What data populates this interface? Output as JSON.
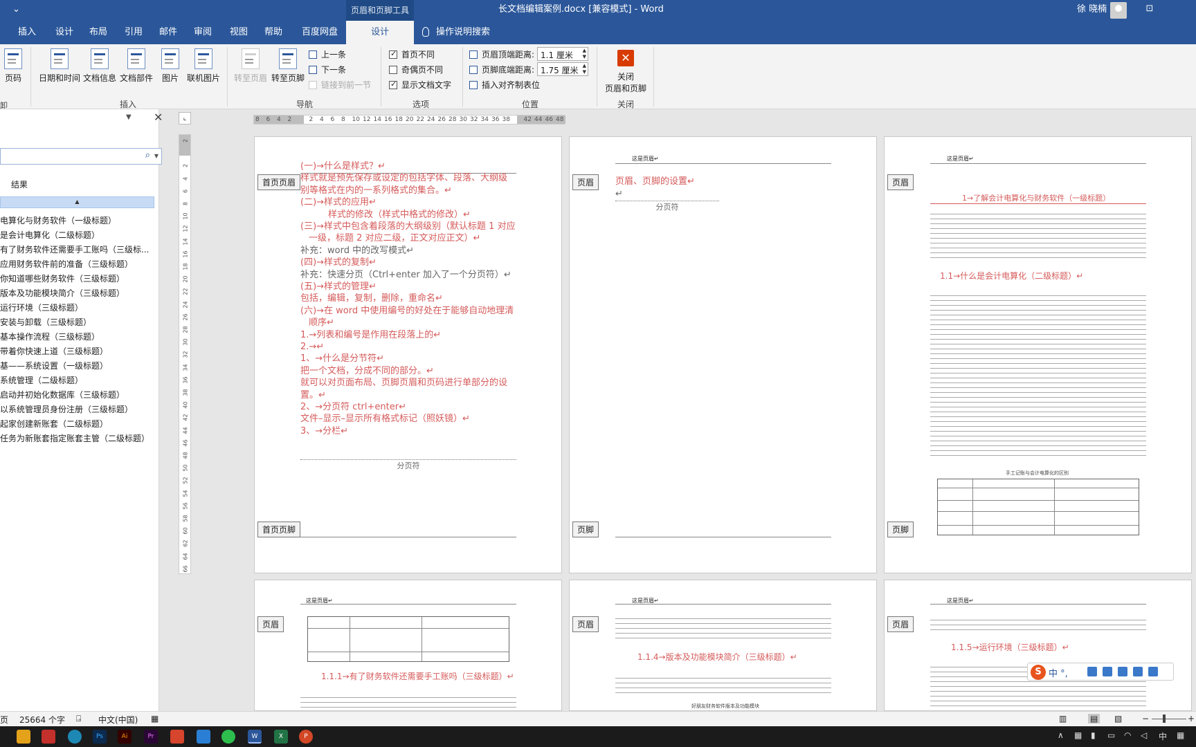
{
  "titlebar": {
    "quick_access": "⌄",
    "context_tab": "页眉和页脚工具",
    "doc_title": "长文档编辑案例.docx [兼容模式]  -  Word",
    "user": "徐 晓楠",
    "ribbon_display_icon": "ribbon-display-icon"
  },
  "tabs": [
    "插入",
    "设计",
    "布局",
    "引用",
    "邮件",
    "审阅",
    "视图",
    "帮助",
    "百度网盘",
    "设计"
  ],
  "tell_me": "操作说明搜索",
  "ribbon": {
    "page_number": "页码",
    "date_time": "日期和时间",
    "doc_info": "文档信息",
    "doc_parts": "文档部件",
    "picture": "图片",
    "online_picture": "联机图片",
    "insert_group": "插入",
    "goto_header": "转至页眉",
    "goto_footer": "转至页脚",
    "previous": "上一条",
    "next": "下一条",
    "link_previous": "链接到前一节",
    "nav_group": "导航",
    "first_page_diff": "首页不同",
    "odd_even_diff": "奇偶页不同",
    "show_doc_text": "显示文档文字",
    "options_group": "选项",
    "header_top_label": "页眉顶端距离:",
    "header_top_value": "1.1 厘米",
    "footer_bottom_label": "页脚底端距离:",
    "footer_bottom_value": "1.75 厘米",
    "insert_align_tab": "插入对齐制表位",
    "position_group": "位置",
    "close_label_1": "关闭",
    "close_label_2": "页眉和页脚",
    "close_group": "关闭",
    "left_stub_1": "印",
    "left_stub_2": "卸"
  },
  "navpane": {
    "results": "结果",
    "items": [
      "电算化与财务软件（一级标题）",
      "是会计电算化（二级标题）",
      "有了财务软件还需要手工账吗（三级标...",
      "应用财务软件前的准备（三级标题）",
      "你知道哪些财务软件（三级标题）",
      "版本及功能模块简介（三级标题）",
      "运行环境（三级标题）",
      "安装与卸载（三级标题）",
      "基本操作流程（三级标题）",
      "带着你快速上道（三级标题）",
      "基——系统设置（一级标题）",
      "系统管理（二级标题）",
      "启动并初始化数据库（三级标题）",
      "以系统管理员身份注册（三级标题）",
      "起家创建新账套（二级标题）",
      "任务为新账套指定账套主管（二级标题）"
    ]
  },
  "ruler": {
    "h_numbers": [
      "8",
      "6",
      "4",
      "2",
      "",
      "2",
      "4",
      "6",
      "8",
      "10",
      "12",
      "14",
      "16",
      "18",
      "20",
      "22",
      "24",
      "26",
      "28",
      "30",
      "32",
      "34",
      "36",
      "38",
      "",
      "42",
      "44",
      "46",
      "48"
    ],
    "v_numbers": [
      "2",
      "",
      "2",
      "4",
      "6",
      "8",
      "10",
      "12",
      "14",
      "16",
      "18",
      "20",
      "22",
      "24",
      "26",
      "28",
      "30",
      "32",
      "34",
      "36",
      "38",
      "40",
      "42",
      "44",
      "46",
      "48",
      "50",
      "52",
      "54",
      "56",
      "58",
      "60",
      "62",
      "64",
      "66"
    ]
  },
  "pages": {
    "p1": {
      "header_tag": "首页页眉",
      "footer_tag": "首页页脚",
      "lines": [
        "(一)→什么是样式？↵",
        "样式就是预先保存或设定的包括字体、段落、大纲级",
        "别等格式在内的一系列格式的集合。↵",
        "(二)→样式的应用↵",
        "样式的修改（样式中格式的修改）↵",
        "(三)→样式中包含着段落的大纲级别（默认标题 1 对应",
        "一级，标题 2 对应二级，正文对应正文）↵",
        "补充：word 中的改写模式↵",
        "(四)→样式的复制↵",
        "补充：快速分页（Ctrl+enter 加入了一个分页符）↵",
        "(五)→样式的管理↵",
        "包括，编辑，复制，删除，重命名↵",
        "(六)→在 word 中使用编号的好处在于能够自动地理清",
        "顺序↵",
        "1.→列表和编号是作用在段落上的↵",
        "2.→↵",
        "1、→什么是分节符↵",
        "把一个文档，分成不同的部分。↵",
        "就可以对页面布局、页脚页眉和页码进行单部分的设",
        "置。↵",
        "2、→分页符 ctrl+enter↵",
        "文件–显示–显示所有格式标记（照妖镜）↵",
        "3、→分栏↵"
      ],
      "page_break": "分页符"
    },
    "p2": {
      "header_tag": "页眉",
      "footer_tag": "页脚",
      "header_text": "这是页眉↵",
      "line1": "页眉、页脚的设置↵",
      "line2": "↵",
      "page_break": "分页符"
    },
    "p3": {
      "header_tag": "页眉",
      "footer_tag": "页脚",
      "header_text": "这是页眉↵",
      "h1": "1→了解会计电算化与财务软件（一级标题）",
      "h2": "1.1→什么是会计电算化（二级标题）↵",
      "table_title": "手工记账与会计电算化的区别"
    },
    "p4": {
      "header_tag": "页眉",
      "header_text": "这是页眉↵",
      "h3": "1.1.1→有了财务软件还需要手工账吗（三级标题）↵"
    },
    "p5": {
      "header_tag": "页眉",
      "header_text": "这是页眉↵",
      "h3": "1.1.4→版本及功能模块简介（三级标题）↵",
      "caption": "好朋友财务软件版本及功能模块"
    },
    "p6": {
      "header_tag": "页眉",
      "header_text": "这是页眉↵",
      "h3": "1.1.5→运行环境（三级标题）↵"
    }
  },
  "statusbar": {
    "page": "页",
    "words": "25664 个字",
    "language": "中文(中国)"
  },
  "ime": {
    "logo": "S",
    "mode": "中 °,"
  },
  "taskbar": {
    "input_lang": "中",
    "icons": [
      "file-explorer-icon",
      "app-red-icon",
      "edge-icon",
      "photoshop-icon",
      "illustrator-icon",
      "premiere-icon",
      "app-bag-icon",
      "search-app-icon",
      "wechat-icon",
      "word-icon",
      "excel-icon",
      "powerpoint-icon"
    ]
  }
}
